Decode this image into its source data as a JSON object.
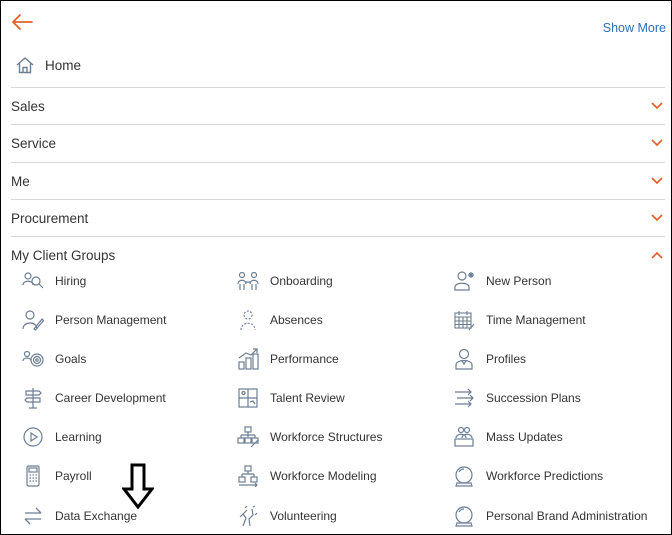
{
  "header": {
    "show_more": "Show More"
  },
  "home": {
    "label": "Home"
  },
  "sections": [
    {
      "label": "Sales",
      "state": "collapsed"
    },
    {
      "label": "Service",
      "state": "collapsed"
    },
    {
      "label": "Me",
      "state": "collapsed"
    },
    {
      "label": "Procurement",
      "state": "collapsed"
    },
    {
      "label": "My Client Groups",
      "state": "expanded"
    }
  ],
  "client_groups": {
    "columns": [
      [
        {
          "label": "Hiring",
          "icon": "hiring-icon"
        },
        {
          "label": "Person Management",
          "icon": "person-management-icon"
        },
        {
          "label": "Goals",
          "icon": "goals-icon"
        },
        {
          "label": "Career Development",
          "icon": "signpost-icon"
        },
        {
          "label": "Learning",
          "icon": "play-circle-icon"
        },
        {
          "label": "Payroll",
          "icon": "calculator-icon"
        },
        {
          "label": "Data Exchange",
          "icon": "exchange-arrows-icon"
        }
      ],
      [
        {
          "label": "Onboarding",
          "icon": "onboarding-icon"
        },
        {
          "label": "Absences",
          "icon": "absences-icon"
        },
        {
          "label": "Performance",
          "icon": "performance-icon"
        },
        {
          "label": "Talent Review",
          "icon": "talent-review-icon"
        },
        {
          "label": "Workforce Structures",
          "icon": "workforce-structures-icon"
        },
        {
          "label": "Workforce Modeling",
          "icon": "workforce-modeling-icon"
        },
        {
          "label": "Volunteering",
          "icon": "volunteering-icon"
        }
      ],
      [
        {
          "label": "New Person",
          "icon": "new-person-icon"
        },
        {
          "label": "Time Management",
          "icon": "calendar-icon"
        },
        {
          "label": "Profiles",
          "icon": "profile-icon"
        },
        {
          "label": "Succession Plans",
          "icon": "succession-icon"
        },
        {
          "label": "Mass Updates",
          "icon": "mass-updates-icon"
        },
        {
          "label": "Workforce Predictions",
          "icon": "crystal-ball-icon"
        },
        {
          "label": "Personal Brand Administration",
          "icon": "brand-icon"
        }
      ]
    ]
  },
  "colors": {
    "accent": "#e2622a",
    "link": "#2d6fb3",
    "icon": "#6b7e93",
    "divider": "#d7d7d7"
  }
}
